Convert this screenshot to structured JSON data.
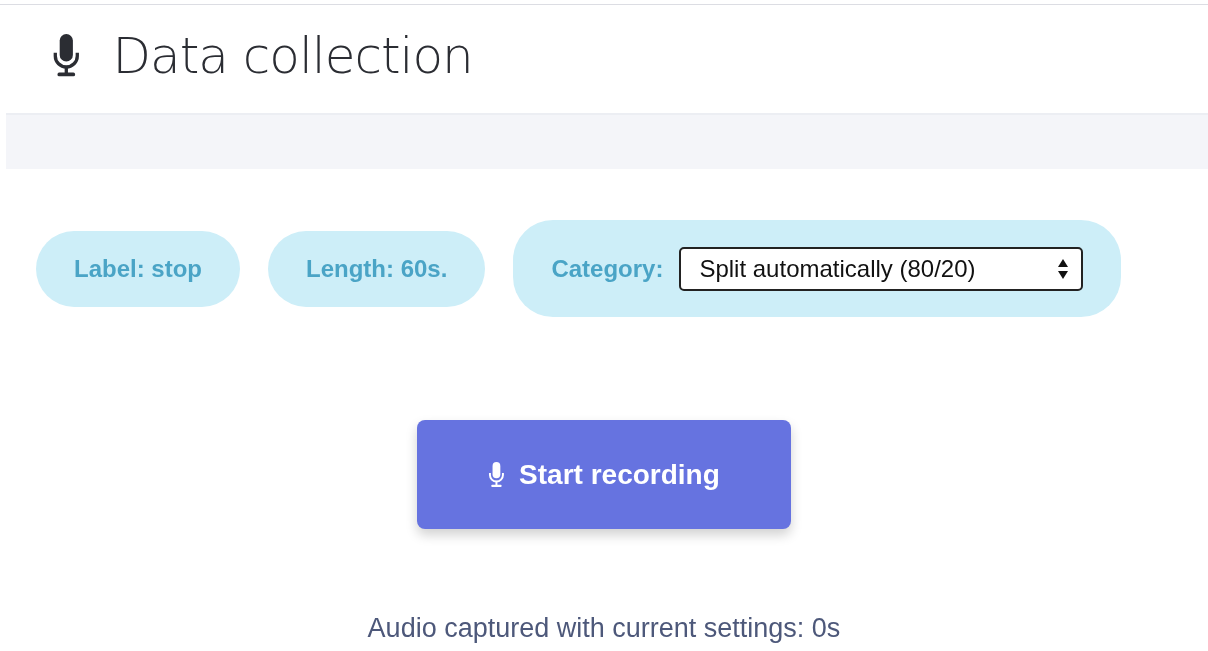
{
  "header": {
    "title": "Data collection"
  },
  "settings": [
    {
      "kind": "pill",
      "text": "Label: stop"
    },
    {
      "kind": "pill",
      "text": "Length: 60s."
    },
    {
      "kind": "select",
      "text": "Category:",
      "value": "Split automatically (80/20)"
    }
  ],
  "record_button": {
    "label": "Start recording"
  },
  "status": "Audio captured with current settings: 0s"
}
